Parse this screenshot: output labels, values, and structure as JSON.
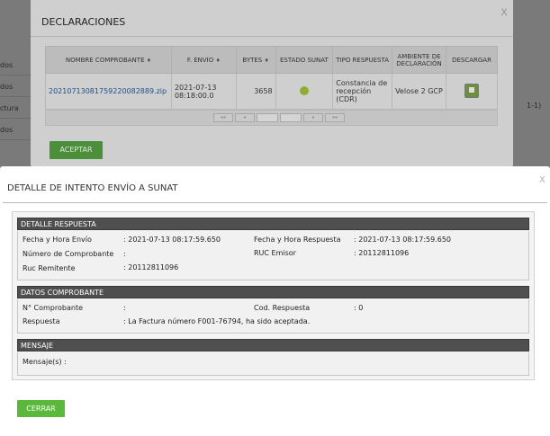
{
  "background": {
    "rows": [
      "dos",
      "dos",
      "ctura",
      "dos"
    ],
    "right_text": "1-1)"
  },
  "back_dialog": {
    "title": "DECLARACIONES",
    "close": "x",
    "columns": [
      "NOMBRE COMPROBANTE",
      "F. ENVÍO",
      "BYTES",
      "ESTADO SUNAT",
      "TIPO RESPUESTA",
      "AMBIENTE DE DECLARACIÓN",
      "DESCARGAR"
    ],
    "row": {
      "file": "20210713081759220082889.zip",
      "date": "2021-07-13 08:18:00.0",
      "bytes": "3658",
      "tipo": "Constancia de recepción (CDR)",
      "ambiente": "Velose 2 GCP"
    },
    "pager": [
      "««",
      "«",
      "",
      "",
      "»",
      "»»"
    ],
    "accept_label": "ACEPTAR"
  },
  "front_dialog": {
    "title": "DETALLE DE INTENTO ENVÍO A SUNAT",
    "close": "x",
    "sections": {
      "respuesta": {
        "header": "DETALLE RESPUESTA",
        "fecha_envio_label": "Fecha y Hora Envío",
        "fecha_envio_value": ": 2021-07-13 08:17:59.650",
        "fecha_resp_label": "Fecha y Hora Respuesta",
        "fecha_resp_value": ": 2021-07-13 08:17:59.650",
        "num_comp_label": "Número de Comprobante",
        "num_comp_value": ":",
        "ruc_emisor_label": "RUC Emisor",
        "ruc_emisor_value": ": 20112811096",
        "ruc_remitente_label": "Ruc Remitente",
        "ruc_remitente_value": ": 20112811096"
      },
      "comprobante": {
        "header": "DATOS COMPROBANTE",
        "n_comp_label": "N° Comprobante",
        "n_comp_value": ":",
        "cod_resp_label": "Cod. Respuesta",
        "cod_resp_value": ": 0",
        "respuesta_label": "Respuesta",
        "respuesta_value": ": La Factura número F001-76794, ha sido aceptada."
      },
      "mensaje": {
        "header": "MENSAJE",
        "mensajes_label": "Mensaje(s) :"
      }
    },
    "close_label": "CERRAR"
  }
}
